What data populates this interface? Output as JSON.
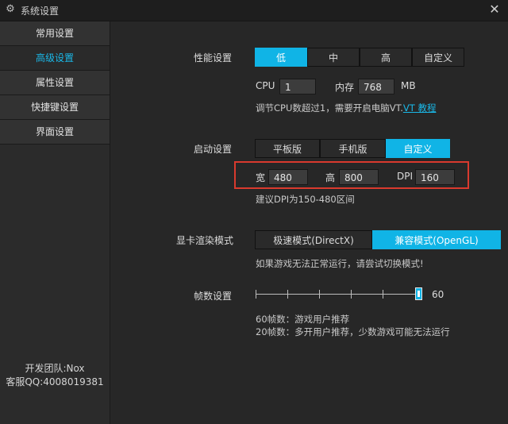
{
  "window": {
    "title": "系统设置",
    "close_symbol": "✕"
  },
  "sidebar": {
    "items": [
      {
        "label": "常用设置",
        "active": false
      },
      {
        "label": "高级设置",
        "active": true
      },
      {
        "label": "属性设置",
        "active": false
      },
      {
        "label": "快捷键设置",
        "active": false
      },
      {
        "label": "界面设置",
        "active": false
      }
    ],
    "footer_team": "开发团队:Nox",
    "footer_qq": "客服QQ:4008019381"
  },
  "performance": {
    "label": "性能设置",
    "options": [
      "低",
      "中",
      "高",
      "自定义"
    ],
    "selected": "低",
    "cpu_label": "CPU",
    "cpu_value": "1",
    "mem_label": "内存",
    "mem_value": "768",
    "mem_unit": "MB",
    "hint": "调节CPU数超过1，需要开启电脑VT.",
    "hint_link": "VT 教程"
  },
  "startup": {
    "label": "启动设置",
    "options": [
      "平板版",
      "手机版",
      "自定义"
    ],
    "selected": "自定义",
    "width_label": "宽",
    "width_value": "480",
    "height_label": "高",
    "height_value": "800",
    "dpi_label": "DPI",
    "dpi_value": "160",
    "hint": "建议DPI为150-480区间"
  },
  "render": {
    "label": "显卡渲染模式",
    "options": [
      "极速模式(DirectX)",
      "兼容模式(OpenGL)"
    ],
    "selected": "兼容模式(OpenGL)",
    "hint": "如果游戏无法正常运行，请尝试切换模式!"
  },
  "fps": {
    "label": "帧数设置",
    "value": "60",
    "level_fraction": 1.0,
    "note1": "60帧数：游戏用户推荐",
    "note2": "20帧数：多开用户推荐，少数游戏可能无法运行"
  },
  "colors": {
    "accent": "#10b4e6",
    "highlight_box": "#d93a2e",
    "background": "#272727"
  },
  "icons": {
    "title": "gear-icon",
    "close": "close-icon"
  }
}
